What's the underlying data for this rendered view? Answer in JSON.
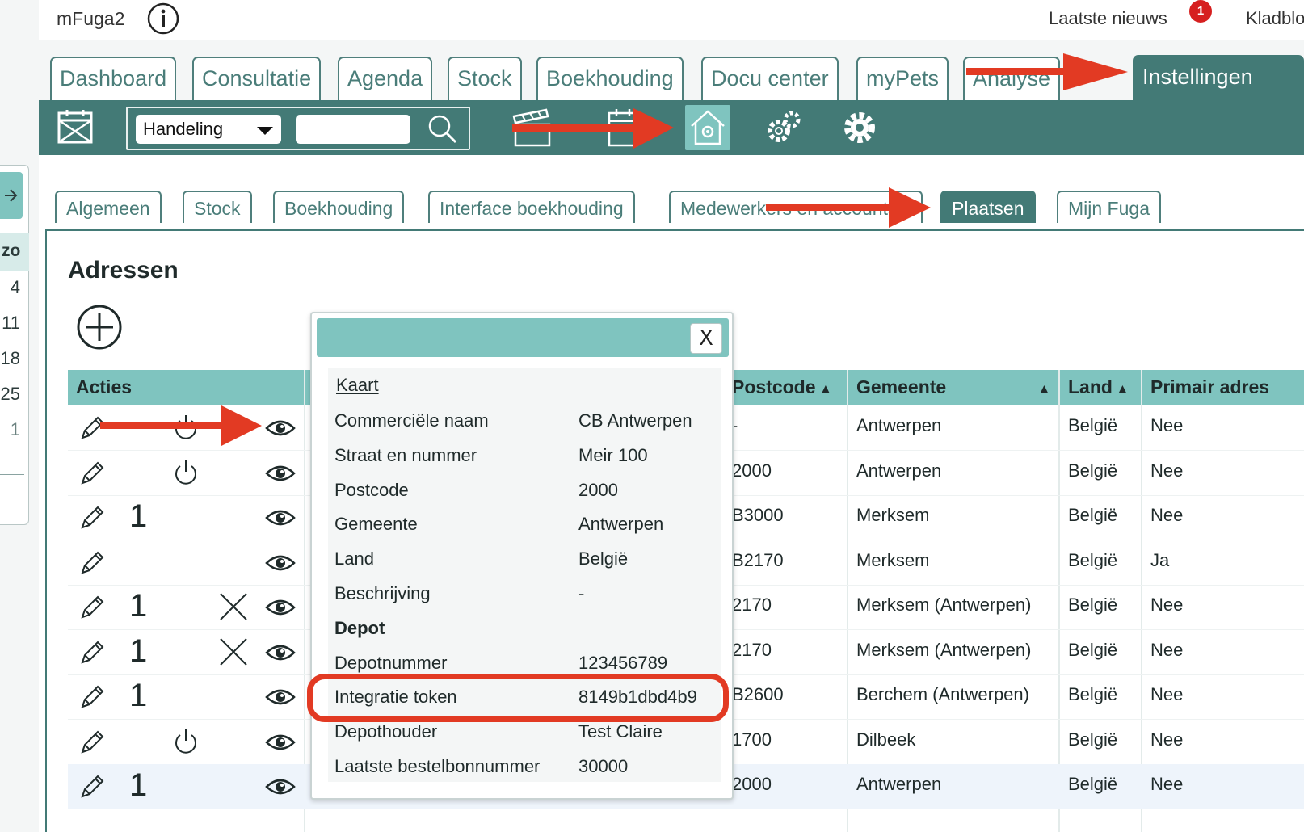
{
  "app": {
    "brand": "mFuga2",
    "news_label": "Laatste nieuws",
    "news_badge": "1",
    "kladblok_label": "Kladblok"
  },
  "mini_calendar": {
    "day_header": "zo",
    "days": [
      "4",
      "11",
      "18",
      "25",
      "1"
    ]
  },
  "main_tabs": [
    {
      "label": "Dashboard"
    },
    {
      "label": "Consultatie"
    },
    {
      "label": "Agenda"
    },
    {
      "label": "Stock"
    },
    {
      "label": "Boekhouding"
    },
    {
      "label": "Docu center"
    },
    {
      "label": "myPets"
    },
    {
      "label": "Analyse"
    },
    {
      "label": "Instellingen",
      "active": true
    }
  ],
  "toolbar": {
    "select_value": "Handeling",
    "search_value": "",
    "icons": [
      "calendar-x-icon",
      "search-icon",
      "clapperboard-icon",
      "clipboard-icon",
      "house-gear-icon",
      "gears-icon",
      "gear-icon"
    ]
  },
  "sub_tabs": [
    {
      "label": "Algemeen"
    },
    {
      "label": "Stock"
    },
    {
      "label": "Boekhouding"
    },
    {
      "label": "Interface boekhouding"
    },
    {
      "label": "Medewerkers en accounts"
    },
    {
      "label": "Plaatsen",
      "active": true
    },
    {
      "label": "Mijn Fuga"
    }
  ],
  "section": {
    "title": "Adressen"
  },
  "table": {
    "headers": {
      "acties": "Acties",
      "postcode": "Postcode",
      "gemeente": "Gemeente",
      "land": "Land",
      "primair": "Primair adres"
    },
    "rows": [
      {
        "count": "",
        "power": true,
        "delete": false,
        "postcode": "-",
        "gemeente": "Antwerpen",
        "land": "België",
        "primair": "Nee"
      },
      {
        "count": "",
        "power": true,
        "delete": false,
        "postcode": "2000",
        "gemeente": "Antwerpen",
        "land": "België",
        "primair": "Nee"
      },
      {
        "count": "1",
        "power": false,
        "delete": false,
        "postcode": "B3000",
        "gemeente": "Merksem",
        "land": "België",
        "primair": "Nee"
      },
      {
        "count": "",
        "power": false,
        "delete": false,
        "postcode": "B2170",
        "gemeente": "Merksem",
        "land": "België",
        "primair": "Ja"
      },
      {
        "count": "1",
        "power": false,
        "delete": true,
        "postcode": "2170",
        "gemeente": "Merksem (Antwerpen)",
        "land": "België",
        "primair": "Nee"
      },
      {
        "count": "1",
        "power": false,
        "delete": true,
        "postcode": "2170",
        "gemeente": "Merksem (Antwerpen)",
        "land": "België",
        "primair": "Nee"
      },
      {
        "count": "1",
        "power": false,
        "delete": false,
        "postcode": "B2600",
        "gemeente": "Berchem (Antwerpen)",
        "land": "België",
        "primair": "Nee"
      },
      {
        "count": "",
        "power": true,
        "delete": false,
        "postcode": "1700",
        "gemeente": "Dilbeek",
        "land": "België",
        "primair": "Nee"
      },
      {
        "count": "1",
        "power": false,
        "delete": false,
        "postcode": "2000",
        "gemeente": "Antwerpen",
        "land": "België",
        "primair": "Nee"
      }
    ]
  },
  "modal": {
    "close_label": "X",
    "map_link": "Kaart",
    "fields": [
      {
        "label": "Commerciële naam",
        "value": "CB Antwerpen"
      },
      {
        "label": "Straat en nummer",
        "value": "Meir 100"
      },
      {
        "label": "Postcode",
        "value": "2000"
      },
      {
        "label": "Gemeente",
        "value": "Antwerpen"
      },
      {
        "label": "Land",
        "value": "België"
      },
      {
        "label": "Beschrijving",
        "value": "-"
      },
      {
        "label": "Depot",
        "value": "",
        "heading": true
      },
      {
        "label": "Depotnummer",
        "value": "123456789"
      },
      {
        "label": "Integratie token",
        "value": "8149b1dbd4b9"
      },
      {
        "label": "Depothouder",
        "value": "Test Claire"
      },
      {
        "label": "Laatste bestelbonnummer",
        "value": "30000"
      }
    ]
  },
  "colors": {
    "accent": "#437a76",
    "accent_light": "#7fc4bf",
    "annotation": "#e23a23",
    "badge": "#d61f1f"
  }
}
